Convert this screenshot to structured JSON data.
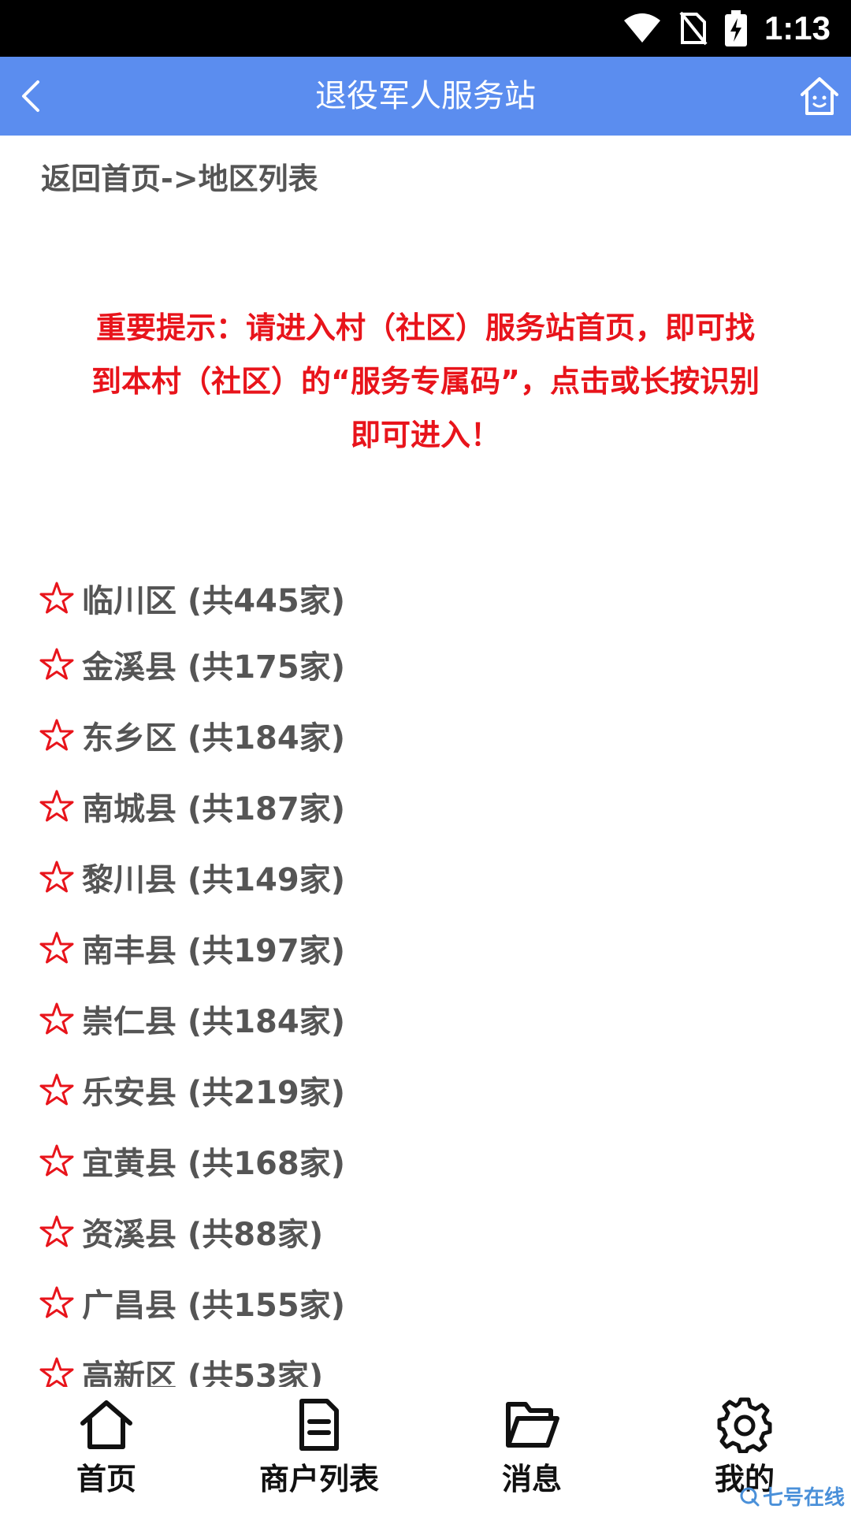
{
  "status_bar": {
    "time": "1:13",
    "icons": [
      "wifi-icon",
      "no-sim-icon",
      "battery-charging-icon"
    ]
  },
  "nav": {
    "title": "退役军人服务站",
    "back_icon": "chevron-left-icon",
    "home_icon": "home-smile-icon"
  },
  "breadcrumb": "返回首页->地区列表",
  "notice": {
    "lines": [
      "重要提示：请进入村（社区）服务站首页，即可找",
      "到本村（社区）的“服务专属码”，点击或长按识别",
      "即可进入！"
    ],
    "color": "#e8141b"
  },
  "regions": [
    {
      "label": "临川区 (共445家)"
    },
    {
      "label": "金溪县 (共175家)"
    },
    {
      "label": "东乡区 (共184家)"
    },
    {
      "label": "南城县 (共187家)"
    },
    {
      "label": "黎川县 (共149家)"
    },
    {
      "label": "南丰县 (共197家)"
    },
    {
      "label": "崇仁县 (共184家)"
    },
    {
      "label": "乐安县 (共219家)"
    },
    {
      "label": "宜黄县 (共168家)"
    },
    {
      "label": "资溪县 (共88家)"
    },
    {
      "label": "广昌县 (共155家)"
    },
    {
      "label": "高新区 (共53家)"
    }
  ],
  "tabs": [
    {
      "label": "首页",
      "icon": "home-icon"
    },
    {
      "label": "商户列表",
      "icon": "document-icon"
    },
    {
      "label": "消息",
      "icon": "folder-open-icon"
    },
    {
      "label": "我的",
      "icon": "gear-icon"
    }
  ],
  "watermark": "七号在线",
  "colors": {
    "nav_bg": "#5b8def",
    "star": "#e8141b",
    "text": "#555555"
  }
}
